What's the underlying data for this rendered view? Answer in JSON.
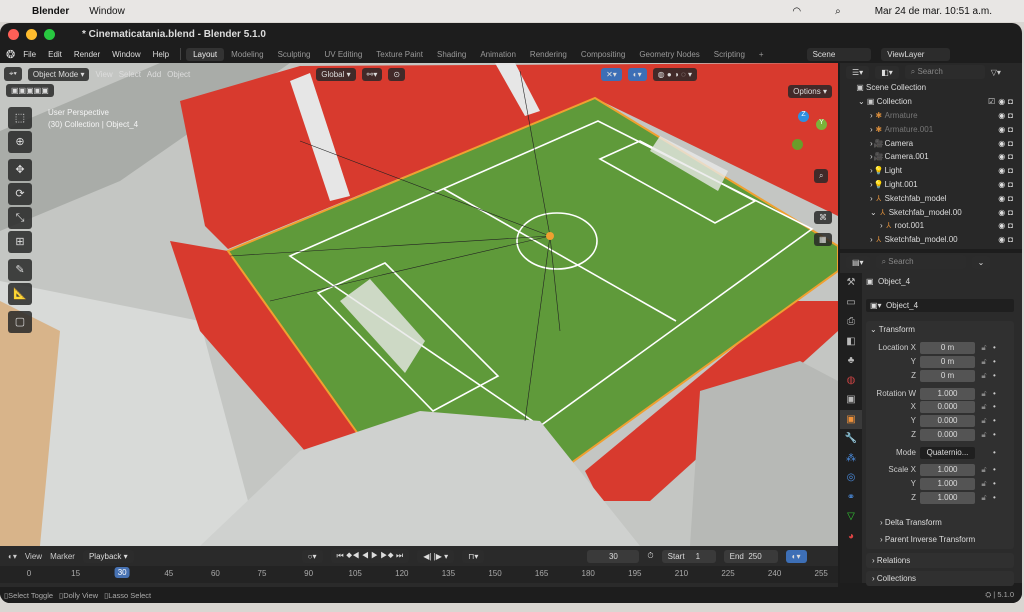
{
  "macos": {
    "app": "Blender",
    "menu": [
      "Window"
    ],
    "datetime": "Mar 24 de mar. 10:51 a.m."
  },
  "window": {
    "title": "* Cinematicatania.blend - Blender 5.1.0"
  },
  "menu": [
    "File",
    "Edit",
    "Render",
    "Window",
    "Help"
  ],
  "workspaces": [
    "Layout",
    "Modeling",
    "Sculpting",
    "UV Editing",
    "Texture Paint",
    "Shading",
    "Animation",
    "Rendering",
    "Compositing",
    "Geometry Nodes",
    "Scripting"
  ],
  "scene": "Scene",
  "view_layer": "ViewLayer",
  "viewport": {
    "mode": "Object Mode",
    "menus": [
      "View",
      "Select",
      "Add",
      "Object"
    ],
    "orientation": "Global",
    "options": "Options",
    "perspective": "User Perspective",
    "context": "(30) Collection | Object_4"
  },
  "outliner": {
    "search": "Search",
    "scene_collection": "Scene Collection",
    "collection": "Collection",
    "items": [
      {
        "name": "Armature",
        "dim": true
      },
      {
        "name": "Armature.001",
        "dim": true
      },
      {
        "name": "Camera"
      },
      {
        "name": "Camera.001"
      },
      {
        "name": "Light"
      },
      {
        "name": "Light.001"
      },
      {
        "name": "Sketchfab_model"
      },
      {
        "name": "Sketchfab_model.00"
      },
      {
        "name": "root.001"
      },
      {
        "name": "Sketchfab_model.00"
      }
    ]
  },
  "properties": {
    "search": "Search",
    "object": "Object_4",
    "object_field": "Object_4",
    "transform": "Transform",
    "location_label": "Location X",
    "location": [
      "0 m",
      "0 m",
      "0 m"
    ],
    "rotation_label": "Rotation W",
    "rotation": [
      "1.000",
      "0.000",
      "0.000",
      "0.000"
    ],
    "mode_label": "Mode",
    "mode": "Quaternio...",
    "scale_label": "Scale X",
    "scale": [
      "1.000",
      "1.000",
      "1.000"
    ],
    "axes": [
      "Y",
      "Z",
      "X"
    ],
    "delta": "Delta Transform",
    "parent_inverse": "Parent Inverse Transform",
    "relations": "Relations",
    "collections": "Collections"
  },
  "timeline": {
    "menus": [
      "View",
      "Marker",
      "Playback"
    ],
    "current_frame": "30",
    "start_label": "Start",
    "start": "1",
    "end_label": "End",
    "end": "250",
    "ticks": [
      "0",
      "15",
      "30",
      "45",
      "60",
      "75",
      "90",
      "105",
      "120",
      "135",
      "150",
      "165",
      "180",
      "195",
      "210",
      "225",
      "240",
      "255"
    ]
  },
  "status": {
    "items": [
      "Select Toggle",
      "Dolly View",
      "Lasso Select"
    ],
    "version": "5.1.0"
  },
  "colors": {
    "accent": "#4772b3",
    "field": "#5f9a3a",
    "stands": "#d63a2e",
    "selection": "#f0a030"
  }
}
